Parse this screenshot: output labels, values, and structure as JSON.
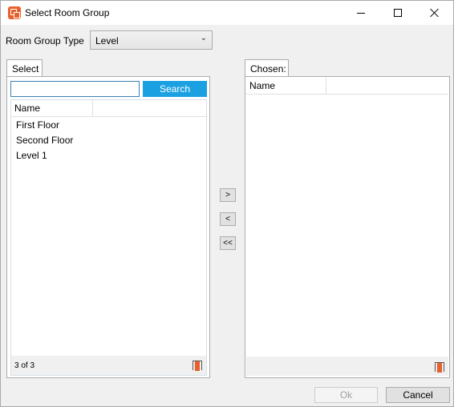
{
  "window": {
    "title": "Select Room Group",
    "icon": "app-icon"
  },
  "room_group_type": {
    "label": "Room Group Type",
    "selected": "Level"
  },
  "select_panel": {
    "tab_label": "Select",
    "search_value": "",
    "search_button": "Search",
    "column_header": "Name",
    "items": [
      "First Floor",
      "Second Floor",
      "Level 1"
    ],
    "count_text": "3 of 3"
  },
  "move_buttons": {
    "add": ">",
    "remove": "<",
    "remove_all": "<<"
  },
  "chosen_panel": {
    "tab_label": "Chosen:",
    "column_header": "Name",
    "items": []
  },
  "buttons": {
    "ok": "Ok",
    "cancel": "Cancel"
  },
  "colors": {
    "accent": "#1ba1e2",
    "brand": "#e8612c"
  }
}
